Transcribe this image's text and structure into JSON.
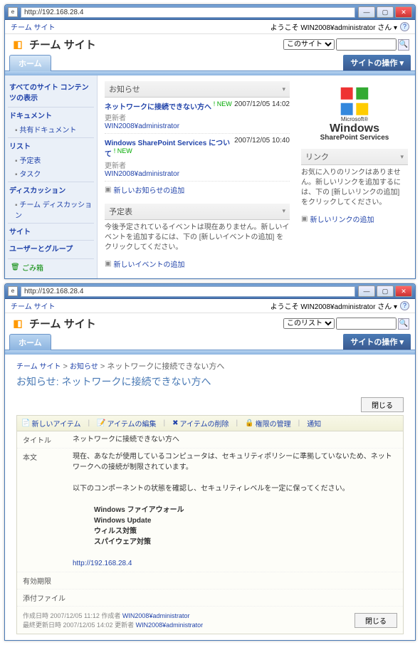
{
  "window1": {
    "url": "http://192.168.28.4",
    "teamSiteLabel": "チーム サイト",
    "welcome": "ようこそ WIN2008¥administrator さん ▾",
    "siteTitle": "チーム サイト",
    "searchScope": "このサイト",
    "homeTab": "ホーム",
    "siteActions": "サイトの操作 ▾",
    "quicklaunch": {
      "viewAll": "すべてのサイト コンテンツの表示",
      "documents": "ドキュメント",
      "sharedDocs": "共有ドキュメント",
      "lists": "リスト",
      "calendar": "予定表",
      "tasks": "タスク",
      "discussion": "ディスカッション",
      "teamDiscussion": "チーム ディスカッション",
      "sites": "サイト",
      "usersGroups": "ユーザーとグループ",
      "recycle": "ごみ箱"
    },
    "announcements": {
      "title": "お知らせ",
      "items": [
        {
          "link": "ネットワークに接続できない方へ",
          "new": "! NEW",
          "date": "2007/12/05 14:02",
          "metaLabel": "更新者",
          "metaUser": "WIN2008¥administrator"
        },
        {
          "link": "Windows SharePoint Services について",
          "new": "! NEW",
          "date": "2007/12/05 10:40",
          "metaLabel": "更新者",
          "metaUser": "WIN2008¥administrator"
        }
      ],
      "addNew": "新しいお知らせの追加"
    },
    "calendar": {
      "title": "予定表",
      "empty": "今後予定されているイベントは現在ありません。新しいイベントを追加するには、下の [新しいイベントの追加] をクリックしてください。",
      "addNew": "新しいイベントの追加"
    },
    "links": {
      "title": "リンク",
      "empty": "お気に入りのリンクはありません。新しいリンクを追加するには、下の [新しいリンクの追加] をクリックしてください。",
      "addNew": "新しいリンクの追加"
    },
    "logo": {
      "ms": "Microsoft®",
      "win": "Windows",
      "sps": "SharePoint Services"
    }
  },
  "window2": {
    "url": "http://192.168.28.4",
    "teamSiteLabel": "チーム サイト",
    "welcome": "ようこそ WIN2008¥administrator さん ▾",
    "siteTitle": "チーム サイト",
    "searchScope": "このリスト",
    "homeTab": "ホーム",
    "siteActions": "サイトの操作 ▾",
    "breadcrumb": {
      "p1": "チーム サイト",
      "p2": "お知らせ",
      "p3": "ネットワークに接続できない方へ"
    },
    "pageTitle": "お知らせ: ネットワークに接続できない方へ",
    "closeBtn": "閉じる",
    "toolbar": {
      "newItem": "新しいアイテム",
      "editItem": "アイテムの編集",
      "deleteItem": "アイテムの削除",
      "managePerm": "権限の管理",
      "notify": "通知"
    },
    "fields": {
      "titleLabel": "タイトル",
      "titleVal": "ネットワークに接続できない方へ",
      "bodyLabel": "本文",
      "bodyL1": "現在、あなたが使用しているコンピュータは、セキュリティポリシーに準拠していないため、ネットワークへの接続が制限されています。",
      "bodyL2": "以下のコンポーネントの状態を確認し、セキュリティレベルを一定に保ってください。",
      "comp1": "Windows ファイアウォール",
      "comp2": "Windows Update",
      "comp3": "ウィルス対策",
      "comp4": "スパイウェア対策",
      "link": "http://192.168.28.4",
      "expireLabel": "有効期限",
      "attachLabel": "添付ファイル"
    },
    "footer": {
      "created": "作成日時 2007/12/05 11:12  作成者",
      "createdUser": "WIN2008¥administrator",
      "modified": "最終更新日時 2007/12/05 14:02  更新者",
      "modifiedUser": "WIN2008¥administrator"
    }
  }
}
